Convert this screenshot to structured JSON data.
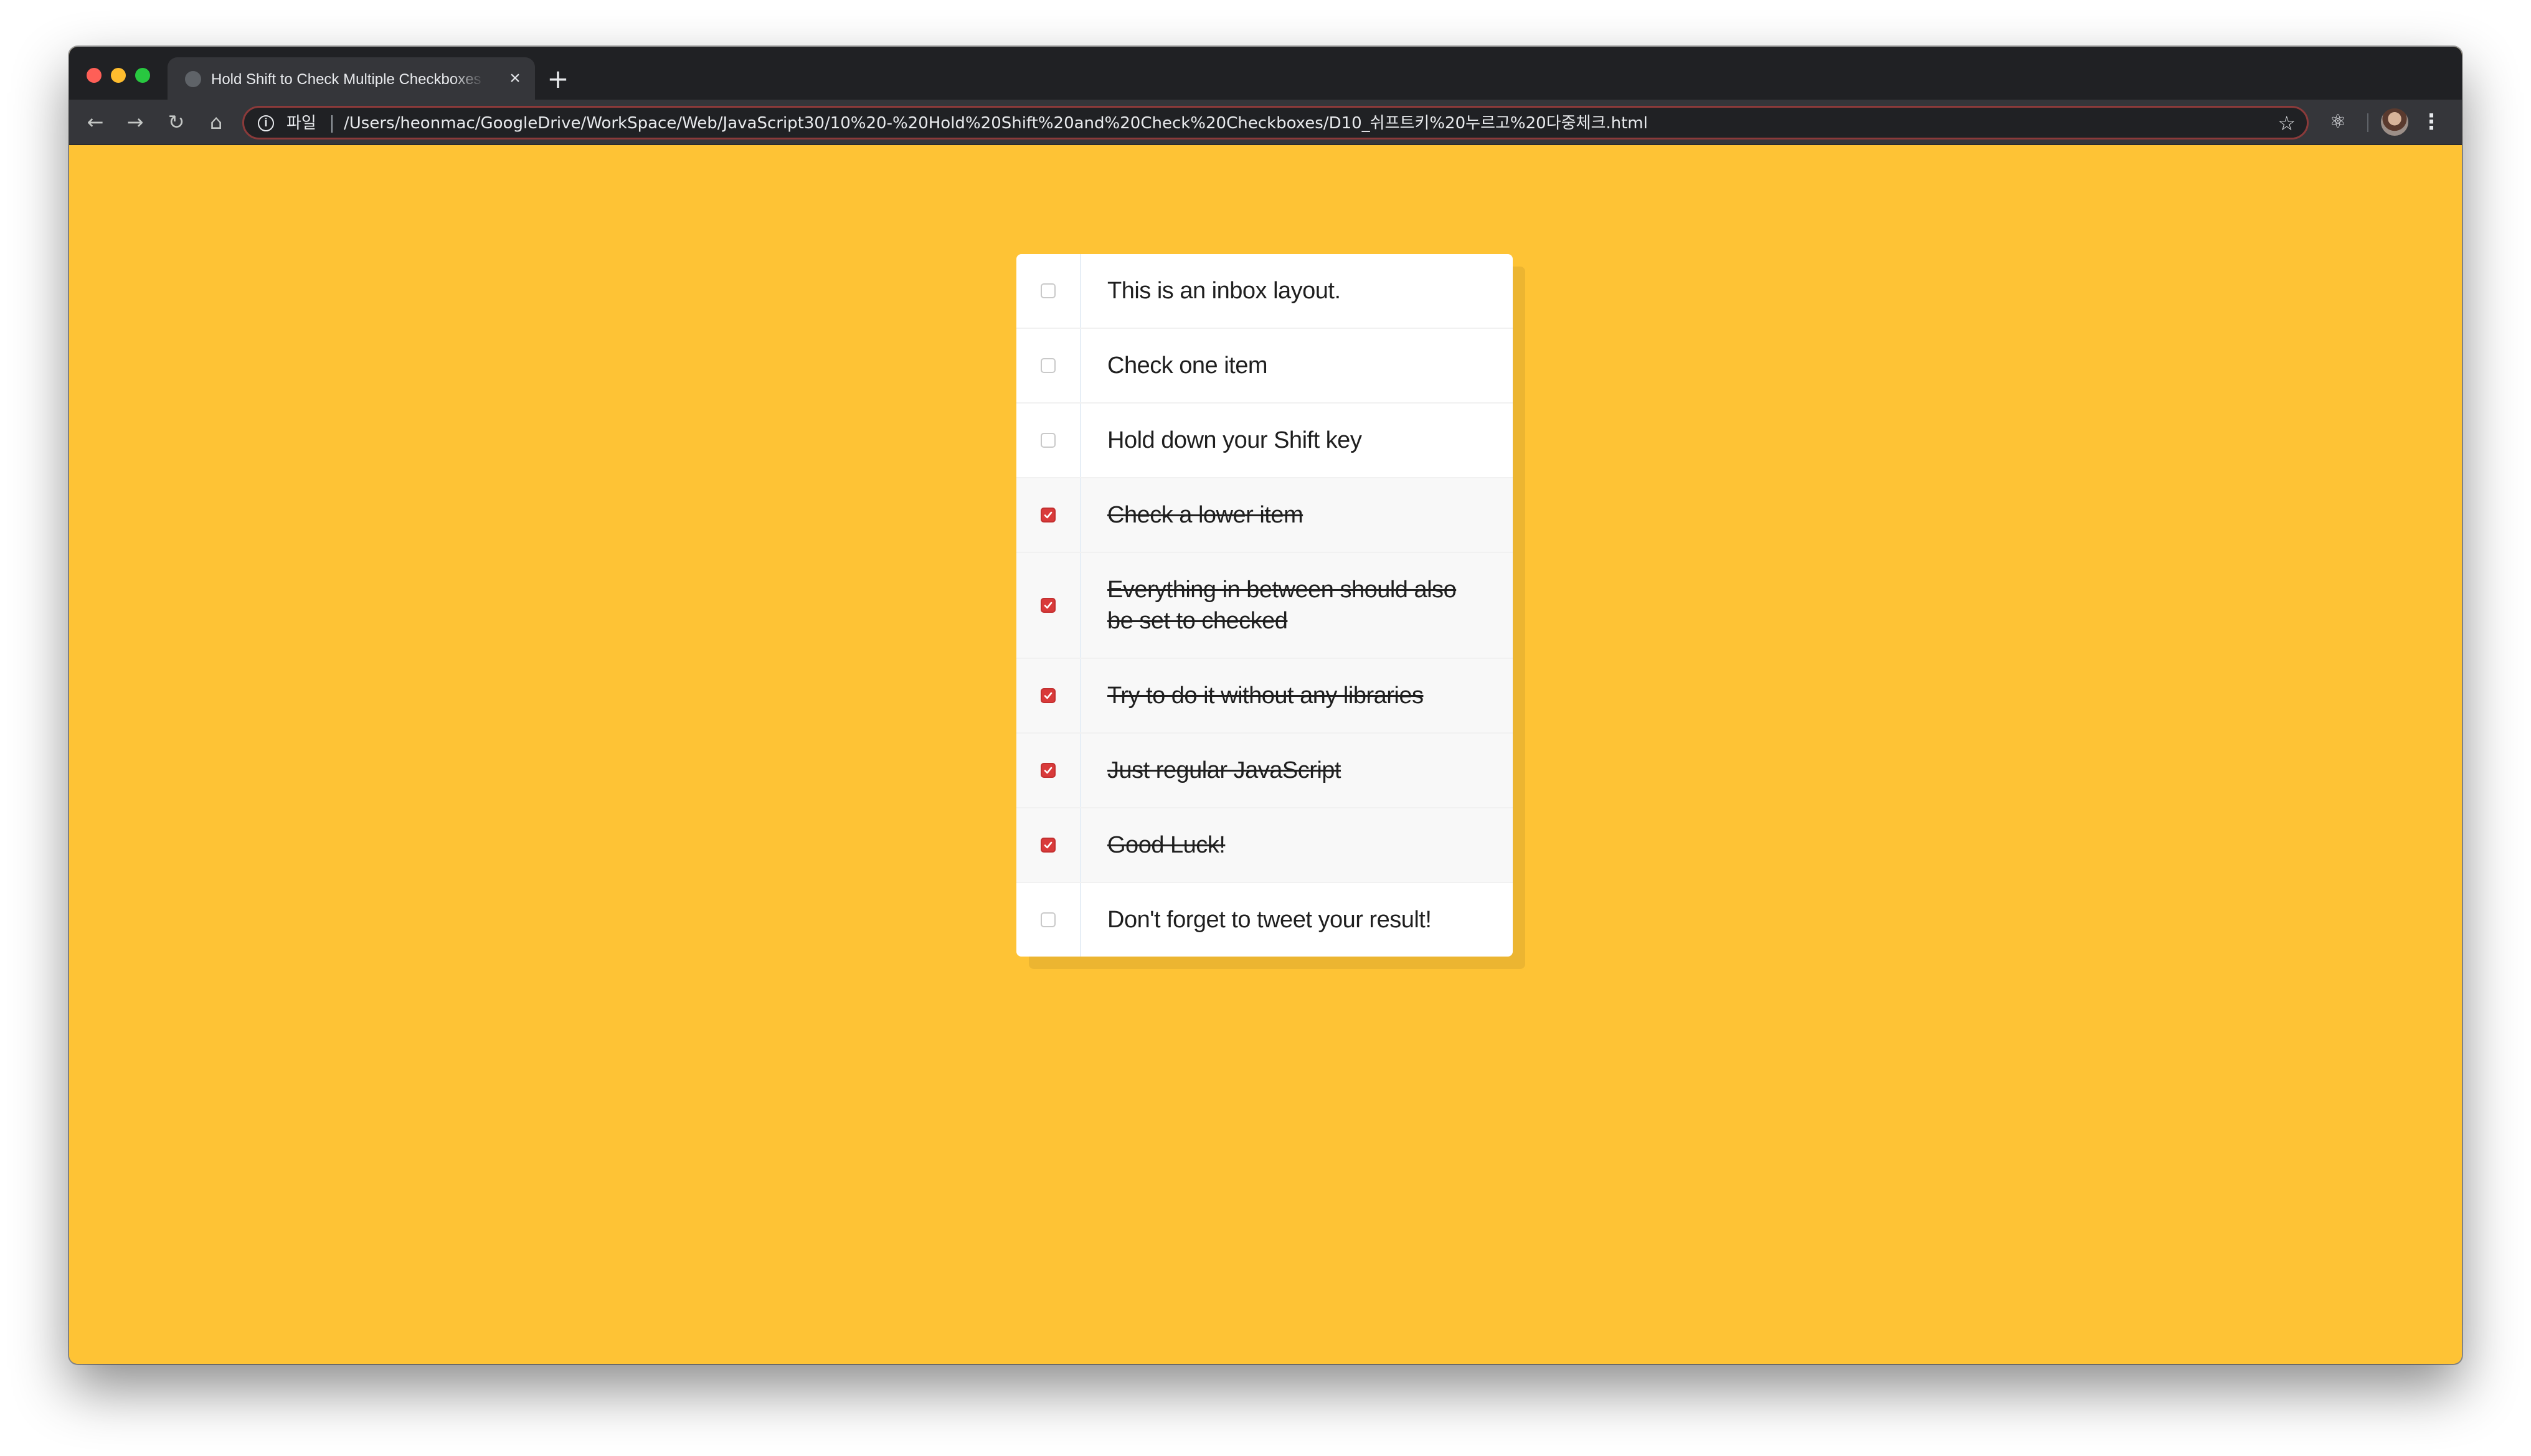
{
  "browser": {
    "tab_title": "Hold Shift to Check Multiple Checkboxes",
    "tab_close": "×",
    "new_tab": "+",
    "scheme_label": "파일",
    "url": "/Users/heonmac/GoogleDrive/WorkSpace/Web/JavaScript30/10%20-%20Hold%20Shift%20and%20Check%20Checkboxes/D10_쉬프트키%20누르고%20다중체크.html",
    "nav": {
      "back": "←",
      "forward": "→",
      "reload": "↻",
      "home": "⌂",
      "info": "i",
      "bookmark": "☆",
      "extension": "⚛",
      "menu": "⋮"
    }
  },
  "inbox": {
    "items": [
      {
        "label": "This is an inbox layout.",
        "checked": false
      },
      {
        "label": "Check one item",
        "checked": false
      },
      {
        "label": "Hold down your Shift key",
        "checked": false
      },
      {
        "label": "Check a lower item",
        "checked": true
      },
      {
        "label": "Everything in between should also be set to checked",
        "checked": true
      },
      {
        "label": "Try to do it without any libraries",
        "checked": true
      },
      {
        "label": "Just regular JavaScript",
        "checked": true
      },
      {
        "label": "Good Luck!",
        "checked": true
      },
      {
        "label": "Don't forget to tweet your result!",
        "checked": false
      }
    ]
  },
  "colors": {
    "page_background": "#fec335",
    "checkbox_checked": "#d93a3a"
  }
}
